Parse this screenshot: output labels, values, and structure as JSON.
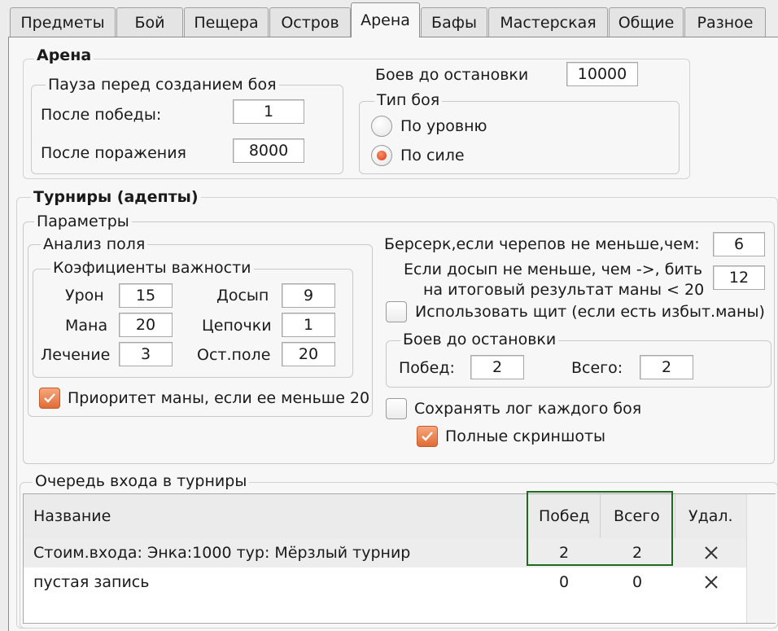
{
  "tabs": [
    "Предметы",
    "Бой",
    "Пещера",
    "Остров",
    "Арена",
    "Бафы",
    "Мастерская",
    "Общие",
    "Разное"
  ],
  "active_tab": "Арена",
  "arena": {
    "title": "Арена",
    "pause": {
      "title": "Пауза перед созданием боя",
      "after_win_label": "После победы:",
      "after_win_value": "1",
      "after_loss_label": "После поражения",
      "after_loss_value": "8000"
    },
    "battles_until_stop_label": "Боев до остановки",
    "battles_until_stop_value": "10000",
    "battle_type": {
      "title": "Тип боя",
      "by_level": "По уровню",
      "by_strength": "По силе",
      "selected": "По силе"
    }
  },
  "tournaments": {
    "title": "Турниры (адепты)",
    "params": {
      "title": "Параметры",
      "field_analysis": {
        "title": "Анализ поля",
        "coefficients": {
          "title": "Коэфициенты важности",
          "damage_label": "Урон",
          "damage_value": "15",
          "armor_label": "Досып",
          "armor_value": "9",
          "mana_label": "Мана",
          "mana_value": "20",
          "chains_label": "Цепочки",
          "chains_value": "1",
          "heal_label": "Лечение",
          "heal_value": "3",
          "rest_label": "Ост.поле",
          "rest_value": "20"
        },
        "mana_priority_label": "Приоритет маны, если ее меньше 20",
        "mana_priority_checked": true
      },
      "berserk_label": "Берсерк,если черепов не меньше,чем:",
      "berserk_value": "6",
      "armor_line1": "Если досып не меньше, чем ->, бить",
      "armor_line2": "на итоговый результат маны < 20",
      "armor_value": "12",
      "use_shield_label": "Использовать щит (если есть избыт.маны)",
      "use_shield_checked": false,
      "stop": {
        "title": "Боев до остановки",
        "wins_label": "Побед:",
        "wins_value": "2",
        "total_label": "Всего:",
        "total_value": "2"
      },
      "save_log_label": "Сохранять лог каждого боя",
      "save_log_checked": false,
      "full_screens_label": "Полные скриншоты",
      "full_screens_checked": true
    },
    "queue": {
      "title": "Очередь входа в турниры",
      "columns": [
        "Название",
        "Побед",
        "Всего",
        "Удал."
      ],
      "rows": [
        {
          "name": "Стоим.входа: Энка:1000  тур: Мёрзлый турнир",
          "wins": "2",
          "total": "2"
        },
        {
          "name": "пустая запись",
          "wins": "0",
          "total": "0"
        }
      ]
    }
  },
  "colors": {
    "highlight": "#1d6b1d",
    "check_on": "#e06c35",
    "radio_on": "#d63a14"
  }
}
